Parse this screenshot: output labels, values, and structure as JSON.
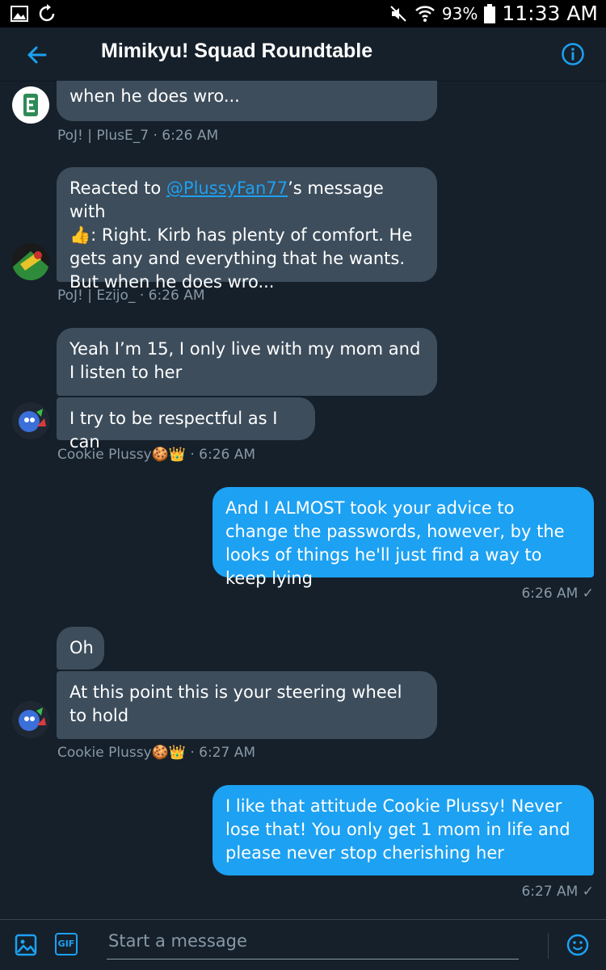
{
  "status_bar": {
    "battery": "93%",
    "time": "11:33 AM"
  },
  "header": {
    "title": "Mimikyu! Squad Roundtable"
  },
  "messages": {
    "m1": {
      "text": "when he does wro...",
      "author": "PoJ! | PlusE_7",
      "time": "6:26 AM",
      "meta": "PoJ! | PlusE_7 · 6:26 AM"
    },
    "m2": {
      "prefix": "Reacted to ",
      "mention": "@PlussyFan77",
      "suffix_line1": "’s message with",
      "emoji": "👍",
      "body": ": Right. Kirb has plenty of comfort. He gets any and everything that he wants. But when he does wro...",
      "meta": "PoJ! | Ezijo_ · 6:26 AM"
    },
    "m3": {
      "text": "Yeah I’m 15, I only live with my mom and I listen to her"
    },
    "m4": {
      "text": "I try to be respectful as I can",
      "meta": "Cookie Plussy🍪👑 · 6:26 AM"
    },
    "m5": {
      "text": "And I ALMOST took your advice to change the passwords, however, by the looks of things he'll just find a way to keep lying",
      "meta": "6:26 AM ✓"
    },
    "m6": {
      "text": "Oh"
    },
    "m7": {
      "text": "At this point this is your steering wheel to hold",
      "meta": "Cookie Plussy🍪👑 · 6:27 AM"
    },
    "m8": {
      "text": "I like that attitude Cookie Plussy! Never lose that! You only get 1 mom in life and please never stop cherishing her",
      "meta": "6:27 AM ✓"
    }
  },
  "composer": {
    "placeholder": "Start a message",
    "gif_label": "GIF"
  },
  "colors": {
    "background": "#15202b",
    "incoming_bubble": "#3d4d5c",
    "outgoing_bubble": "#1da1f2",
    "accent": "#1da1f2",
    "meta_text": "#8899a6"
  }
}
